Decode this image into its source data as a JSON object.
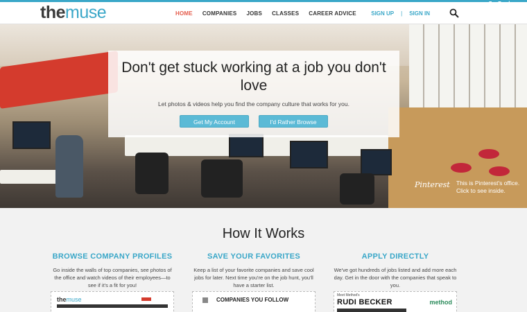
{
  "header": {
    "logo_the": "the",
    "logo_muse": "muse",
    "nav": [
      "HOME",
      "COMPANIES",
      "JOBS",
      "CLASSES",
      "CAREER ADVICE"
    ],
    "sign_up": "SIGN UP",
    "separator": "|",
    "sign_in": "SIGN IN",
    "employers_tab": "For Employers",
    "search_icon": "search-icon"
  },
  "hero": {
    "headline": "Don't get stuck working at a job you don't love",
    "subtext": "Let photos & videos help you find the company culture that works for you.",
    "btn_account": "Get My Account",
    "btn_browse": "I'd Rather Browse",
    "pinterest_logo": "Pinterest",
    "pinterest_caption": "This is Pinterest's office. Click to see inside."
  },
  "how": {
    "title": "How It Works",
    "columns": [
      {
        "heading": "BROWSE COMPANY PROFILES",
        "text": "Go inside the walls of top companies, see photos of the office and watch videos of their employees—to see if it's a fit for you!"
      },
      {
        "heading": "SAVE YOUR FAVORITES",
        "text": "Keep a list of your favorite companies and save cool jobs for later. Next time you're on the job hunt, you'll have a starter list."
      },
      {
        "heading": "APPLY DIRECTLY",
        "text": "We've got hundreds of jobs listed and add more each day. Get in the door with the companies that speak to you."
      }
    ],
    "thumb1_logo_the": "the",
    "thumb1_logo_muse": "muse",
    "thumb2_label": "COMPANIES YOU FOLLOW",
    "thumb3_meet": "Meet Method's",
    "thumb3_name": "RUDI BECKER",
    "thumb3_brand": "method"
  },
  "colors": {
    "accent": "#3aa7c8",
    "active_nav": "#e45a4a"
  }
}
